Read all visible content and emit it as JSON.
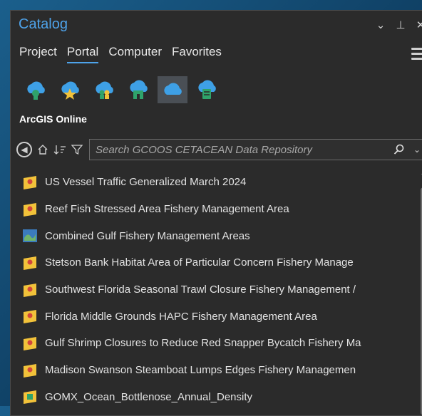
{
  "window": {
    "title": "Catalog",
    "controls": [
      "chevron-down-icon",
      "pin-icon",
      "close-icon"
    ]
  },
  "tabs": [
    {
      "label": "Project",
      "active": false
    },
    {
      "label": "Portal",
      "active": true
    },
    {
      "label": "Computer",
      "active": false
    },
    {
      "label": "Favorites",
      "active": false
    }
  ],
  "portal_buttons": [
    {
      "icon": "my-content-cloud-icon",
      "selected": false
    },
    {
      "icon": "favorites-cloud-icon",
      "selected": false
    },
    {
      "icon": "groups-cloud-icon",
      "selected": false
    },
    {
      "icon": "organization-cloud-icon",
      "selected": false
    },
    {
      "icon": "arcgis-online-cloud-icon",
      "selected": true
    },
    {
      "icon": "living-atlas-cloud-icon",
      "selected": false
    }
  ],
  "section": {
    "label": "ArcGIS Online"
  },
  "search": {
    "placeholder": "Search GCOOS CETACEAN Data Repository",
    "value": ""
  },
  "items": [
    {
      "label": "US Vessel Traffic Generalized March 2024",
      "icon": "feature-layer-icon"
    },
    {
      "label": "Reef Fish Stressed Area Fishery Management Area",
      "icon": "feature-layer-icon"
    },
    {
      "label": "Combined Gulf Fishery Management Areas",
      "icon": "map-icon"
    },
    {
      "label": "Stetson Bank Habitat Area of Particular Concern Fishery Manage",
      "icon": "feature-layer-icon"
    },
    {
      "label": "Southwest Florida Seasonal Trawl Closure Fishery Management /",
      "icon": "feature-layer-icon"
    },
    {
      "label": "Florida Middle Grounds HAPC Fishery Management Area",
      "icon": "feature-layer-icon"
    },
    {
      "label": "Gulf Shrimp Closures to Reduce Red Snapper Bycatch Fishery Ma",
      "icon": "feature-layer-icon"
    },
    {
      "label": "Madison Swanson Steamboat Lumps Edges Fishery Managemen",
      "icon": "feature-layer-icon"
    },
    {
      "label": "GOMX_Ocean_Bottlenose_Annual_Density",
      "icon": "raster-layer-icon"
    }
  ],
  "colors": {
    "accent": "#4ea3ea",
    "panel_bg": "#2b2b2b",
    "cloud_blue": "#3ea0e6",
    "cloud_green": "#2fa36b",
    "layer_yellow": "#f2c23a",
    "layer_red": "#d2463c"
  }
}
